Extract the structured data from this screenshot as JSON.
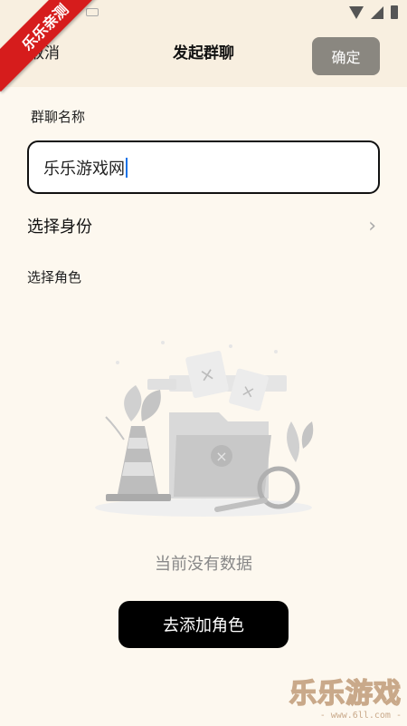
{
  "ribbon": {
    "text": "乐乐亲测"
  },
  "header": {
    "cancel_label": "取消",
    "title": "发起群聊",
    "confirm_label": "确定"
  },
  "form": {
    "group_name_label": "群聊名称",
    "group_name_value": "乐乐游戏网",
    "identity_label": "选择身份",
    "role_label": "选择角色"
  },
  "empty_state": {
    "message": "当前没有数据",
    "add_button_label": "去添加角色"
  },
  "watermark": {
    "title": "乐乐游戏",
    "url": "- www.6ll.com -"
  },
  "colors": {
    "background": "#fdf8ef",
    "header_bg": "#f8efe0",
    "confirm_btn": "#8a8780",
    "primary_btn": "#000000",
    "ribbon": "#d61c1c"
  }
}
